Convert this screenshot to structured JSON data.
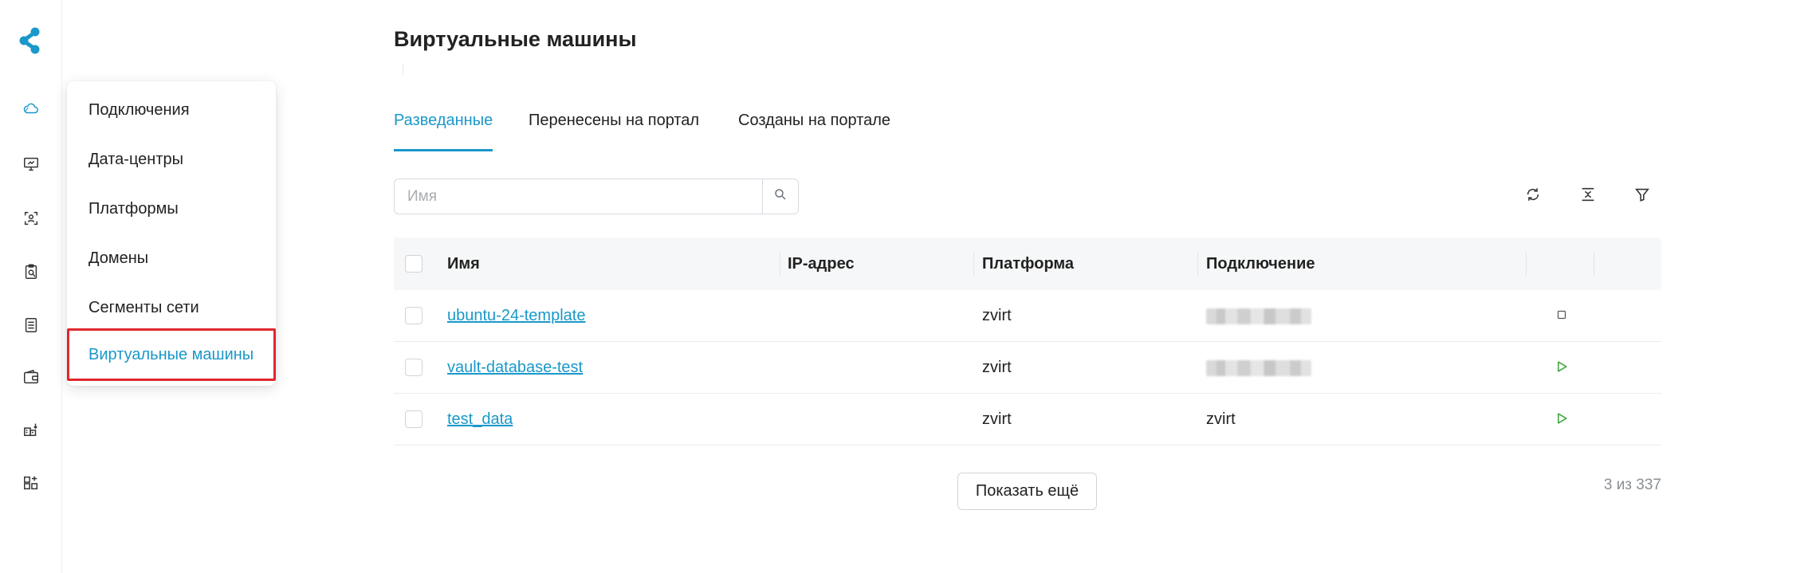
{
  "page": {
    "title": "Виртуальные машины"
  },
  "rail": {
    "items": [
      {
        "icon": "cloud-icon"
      },
      {
        "icon": "monitor-icon"
      },
      {
        "icon": "scan-user-icon"
      },
      {
        "icon": "clipboard-icon"
      },
      {
        "icon": "document-list-icon"
      },
      {
        "icon": "wallet-icon"
      },
      {
        "icon": "building-icon"
      },
      {
        "icon": "blocks-icon"
      }
    ]
  },
  "menu": {
    "items": [
      {
        "label": "Подключения"
      },
      {
        "label": "Дата-центры"
      },
      {
        "label": "Платформы"
      },
      {
        "label": "Домены"
      },
      {
        "label": "Сегменты сети"
      },
      {
        "label": "Виртуальные машины"
      }
    ],
    "active_index": 5
  },
  "tabs": [
    {
      "label": "Разведанные",
      "active": true
    },
    {
      "label": "Перенесены на портал",
      "active": false
    },
    {
      "label": "Созданы на портале",
      "active": false
    }
  ],
  "search": {
    "placeholder": "Имя",
    "value": ""
  },
  "toolbar": {
    "icons": [
      "refresh-icon",
      "collapse-icon",
      "filter-icon"
    ]
  },
  "table": {
    "columns": [
      "Имя",
      "IP-адрес",
      "Платформа",
      "Подключение"
    ],
    "rows": [
      {
        "name": "ubuntu-24-template",
        "ip": "",
        "platform": "zvirt",
        "connection": "",
        "connection_redacted": true,
        "action": "stop-icon"
      },
      {
        "name": "vault-database-test",
        "ip": "",
        "platform": "zvirt",
        "connection": "",
        "connection_redacted": true,
        "action": "play-icon"
      },
      {
        "name": "test_data",
        "ip": "",
        "platform": "zvirt",
        "connection": "zvirt",
        "connection_redacted": false,
        "action": "play-icon"
      }
    ]
  },
  "footer": {
    "more_label": "Показать ещё",
    "count_text": "3 из 337"
  },
  "colors": {
    "accent": "#1a98c9",
    "highlight": "#e0272e",
    "play": "#3aa335"
  }
}
